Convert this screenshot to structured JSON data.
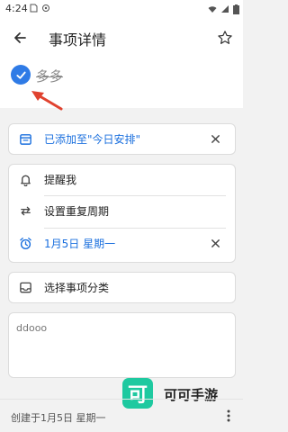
{
  "status_bar": {
    "time": "4:24"
  },
  "header": {
    "title": "事项详情"
  },
  "task": {
    "name": "多多",
    "completed": true
  },
  "today_card": {
    "label": "已添加至\"今日安排\""
  },
  "options": {
    "remind_label": "提醒我",
    "repeat_label": "设置重复周期",
    "date_label": "1月5日 星期一"
  },
  "category": {
    "label": "选择事项分类"
  },
  "note": {
    "text": "ddooo"
  },
  "footer": {
    "created": "创建于1月5日 星期一"
  },
  "watermark": {
    "logo_char": "可",
    "text": "可可手游"
  },
  "colors": {
    "accent": "#1a6fde",
    "check": "#2f7be6",
    "annotation": "#e0422f",
    "brand": "#1ec9a0"
  }
}
